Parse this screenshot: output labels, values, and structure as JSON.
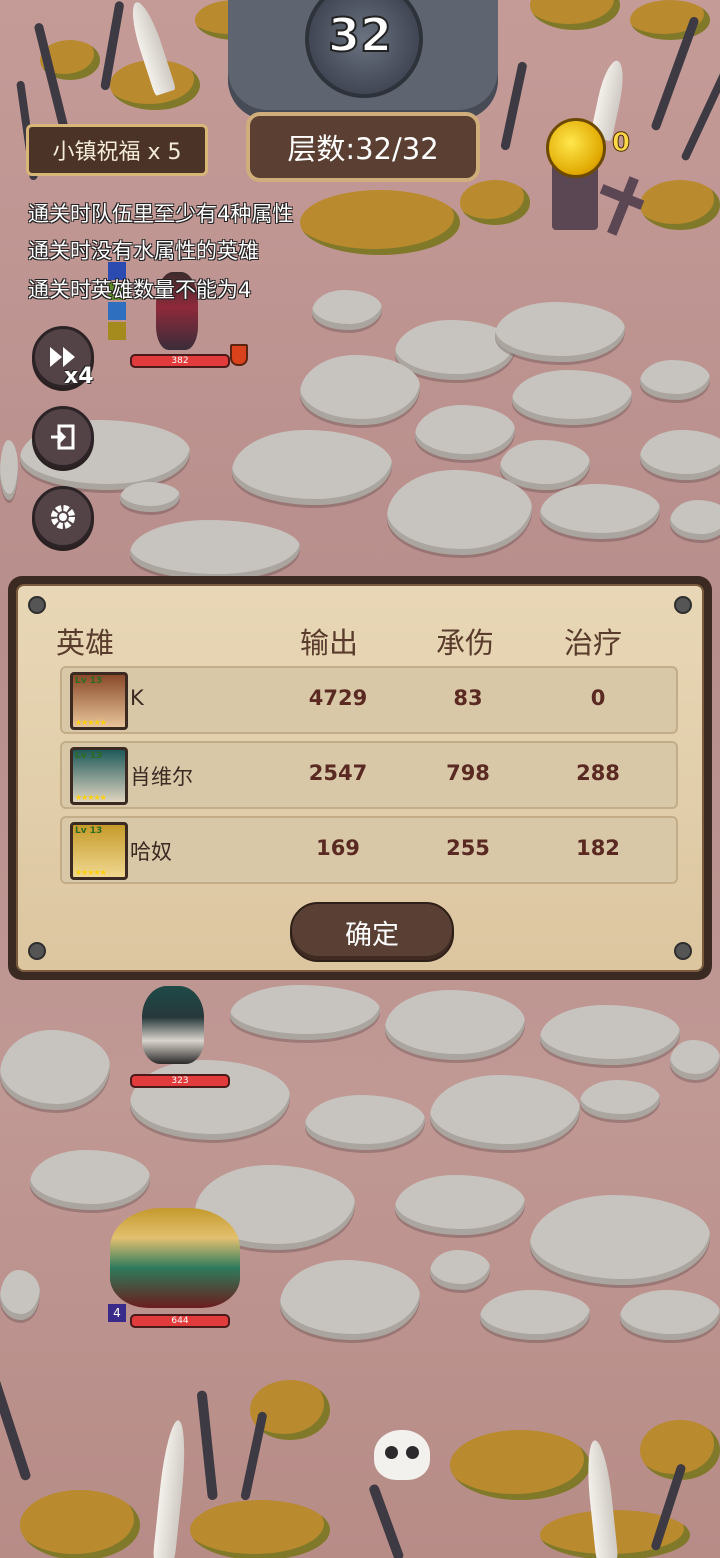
{
  "top": {
    "floor_number": "32",
    "blessing": "小镇祝福 x 5",
    "layer": "层数:32/32",
    "coins": "0"
  },
  "conditions": [
    "通关时队伍里至少有4种属性",
    "通关时没有水属性的英雄",
    "通关时英雄数量不能为4"
  ],
  "controls": {
    "speed_label": "x4"
  },
  "units": {
    "enemy_hp": "382",
    "ally1_hp": "323",
    "ally2_hp": "644",
    "ally2_badge": "4"
  },
  "result": {
    "headers": {
      "hero": "英雄",
      "damage": "输出",
      "taken": "承伤",
      "heal": "治疗"
    },
    "rows": [
      {
        "name": "K",
        "damage": "4729",
        "taken": "83",
        "heal": "0",
        "lv": "Lv 13",
        "stars": "★★★★★"
      },
      {
        "name": "肖维尔",
        "damage": "2547",
        "taken": "798",
        "heal": "288",
        "lv": "Lv 13",
        "stars": "★★★★★"
      },
      {
        "name": "哈奴",
        "damage": "169",
        "taken": "255",
        "heal": "182",
        "lv": "Lv 13",
        "stars": "★★★★★"
      }
    ],
    "confirm_label": "确定"
  },
  "colors": {
    "panel_bg": "#e8d7b6",
    "hp_red": "#e23b3b",
    "coin_gold": "#ffd84a"
  }
}
